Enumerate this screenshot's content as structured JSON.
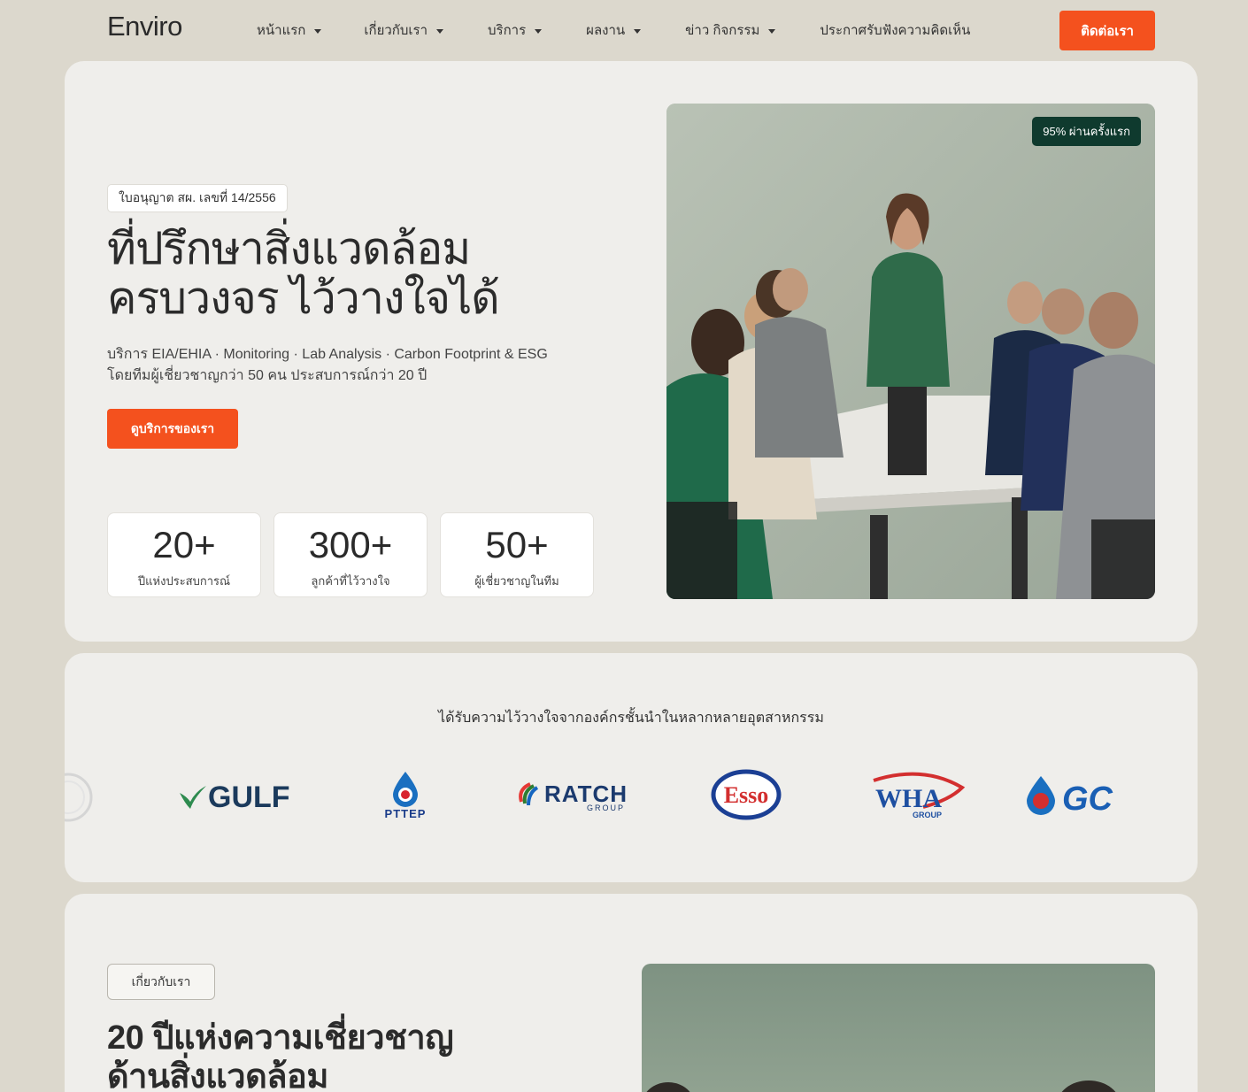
{
  "nav": {
    "logo": "Enviro",
    "items": [
      {
        "label": "หน้าแรก",
        "dropdown": true
      },
      {
        "label": "เกี่ยวกับเรา",
        "dropdown": true
      },
      {
        "label": "บริการ",
        "dropdown": true
      },
      {
        "label": "ผลงาน",
        "dropdown": true
      },
      {
        "label": "ข่าว กิจกรรม",
        "dropdown": true
      },
      {
        "label": "ประกาศรับฟังความคิดเห็น",
        "dropdown": false
      }
    ],
    "contact_label": "ติดต่อเรา"
  },
  "hero": {
    "license": "ใบอนุญาต สผ. เลขที่ 14/2556",
    "title_line1": "ที่ปรึกษาสิ่งแวดล้อม",
    "title_line2": "ครบวงจร ไว้วางใจได้",
    "sub_line1": "บริการ EIA/EHIA · Monitoring · Lab Analysis · Carbon Footprint & ESG",
    "sub_line2": "โดยทีมผู้เชี่ยวชาญกว่า 50 คน ประสบการณ์กว่า 20 ปี",
    "cta": "ดูบริการของเรา",
    "stats": [
      {
        "value": "20+",
        "label": "ปีแห่งประสบการณ์"
      },
      {
        "value": "300+",
        "label": "ลูกค้าที่ไว้วางใจ"
      },
      {
        "value": "50+",
        "label": "ผู้เชี่ยวชาญในทีม"
      }
    ],
    "badge": "95% ผ่านครั้งแรก"
  },
  "clients": {
    "title": "ได้รับความไว้วางใจจากองค์กรชั้นนำในหลากหลายอุตสาหกรรม",
    "logos": {
      "gulf": "GULF",
      "pttep": "PTTEP",
      "ratch": "RATCH",
      "ratch_sub": "GROUP",
      "esso": "Esso",
      "wha": "WHA",
      "wha_sub": "GROUP",
      "gc": "GC"
    }
  },
  "about": {
    "tag": "เกี่ยวกับเรา",
    "title_line1": "20 ปีแห่งความเชี่ยวชาญ",
    "title_line2": "ด้านสิ่งแวดล้อม"
  },
  "colors": {
    "accent": "#f4511e",
    "page_bg": "#dcd8cd",
    "card_bg": "#efeeeb",
    "badge_bg": "#0f3a2e"
  }
}
